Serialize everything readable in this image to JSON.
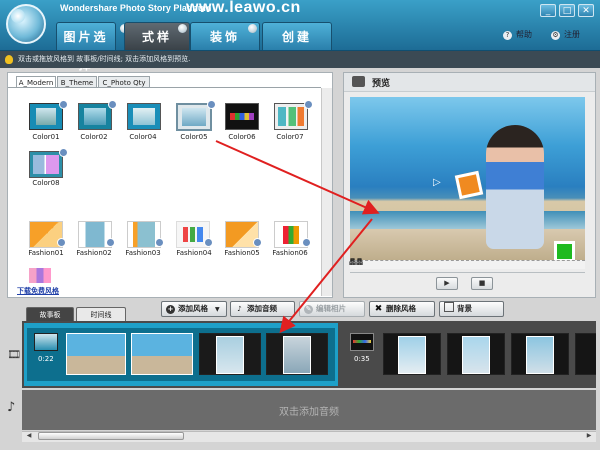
{
  "app": {
    "title": "Wondershare Photo Story Platinum",
    "watermark": "www.leawo.cn"
  },
  "window_buttons": [
    "_",
    "□",
    "✕"
  ],
  "main_tabs": [
    {
      "label": "图片选择"
    },
    {
      "label": "式样"
    },
    {
      "label": "装饰"
    },
    {
      "label": "创建"
    }
  ],
  "help": {
    "help_label": "帮助",
    "register_label": "注册"
  },
  "hint": "双击或拖放风格到 故事板/时间线; 双击添加风格到预览.",
  "style_tabs": [
    "A_Modern",
    "B_Theme",
    "C_Photo Qty"
  ],
  "styles_row1": [
    "Color01",
    "Color02",
    "Color04",
    "Color05",
    "Color06",
    "Color07"
  ],
  "styles_row2": [
    "Color08"
  ],
  "styles_row3": [
    "Fashion01",
    "Fashion02",
    "Fashion03",
    "Fashion04",
    "Fashion05",
    "Fashion06"
  ],
  "download_link": "下载免费风格",
  "preview": {
    "title": "预览",
    "caption": "晶晶"
  },
  "toolbar": {
    "add_style": "添加风格",
    "add_music": "添加音频",
    "edit_photo": "编辑相片",
    "delete_style": "删除风格",
    "background": "背景"
  },
  "timeline_tabs": [
    "故事板",
    "时间线"
  ],
  "timeline": {
    "duration1": "0:22",
    "duration2": "0:35",
    "audio_hint": "双击添加音频"
  },
  "colors": {
    "accent": "#1ea0c8",
    "header": "#2a84b0",
    "arrow": "#e02020"
  }
}
